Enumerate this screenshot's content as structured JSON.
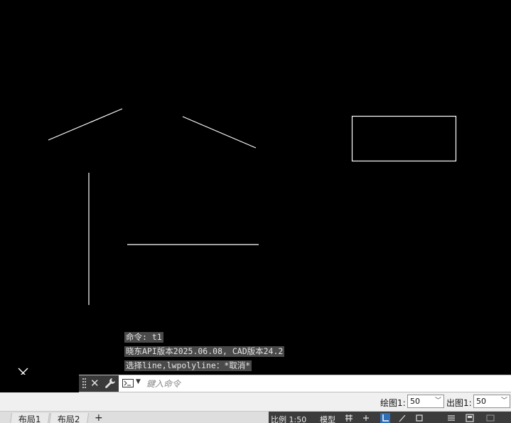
{
  "command_history": [
    "命令: t1",
    "晓东API版本2025.06.08, CAD版本24.2",
    "选择line,lwpolyline：*取消*"
  ],
  "command_line": {
    "placeholder": "鍵入命令"
  },
  "scale_bar": {
    "draw_label": "绘图1:",
    "draw_value": "50",
    "print_label": "出图1:",
    "print_value": "50"
  },
  "status_bar": {
    "tabs": [
      "布局1",
      "布局2"
    ],
    "add_tab_label": "+",
    "scale_text": "比例 1:50",
    "model_text": "模型"
  },
  "colors": {
    "canvas_bg": "#000000",
    "entity_stroke": "#ffffff",
    "history_bg": "#4a4a4a",
    "active_status": "#2f6fb8"
  },
  "icons": [
    "ucs-icon",
    "grip-icon",
    "close-icon",
    "wrench-icon",
    "command-prompt-icon",
    "chevron-down-icon",
    "grid-icon",
    "snap-icon",
    "ortho-icon",
    "polar-icon",
    "osnap-icon",
    "settings-icon",
    "layout-icon"
  ]
}
